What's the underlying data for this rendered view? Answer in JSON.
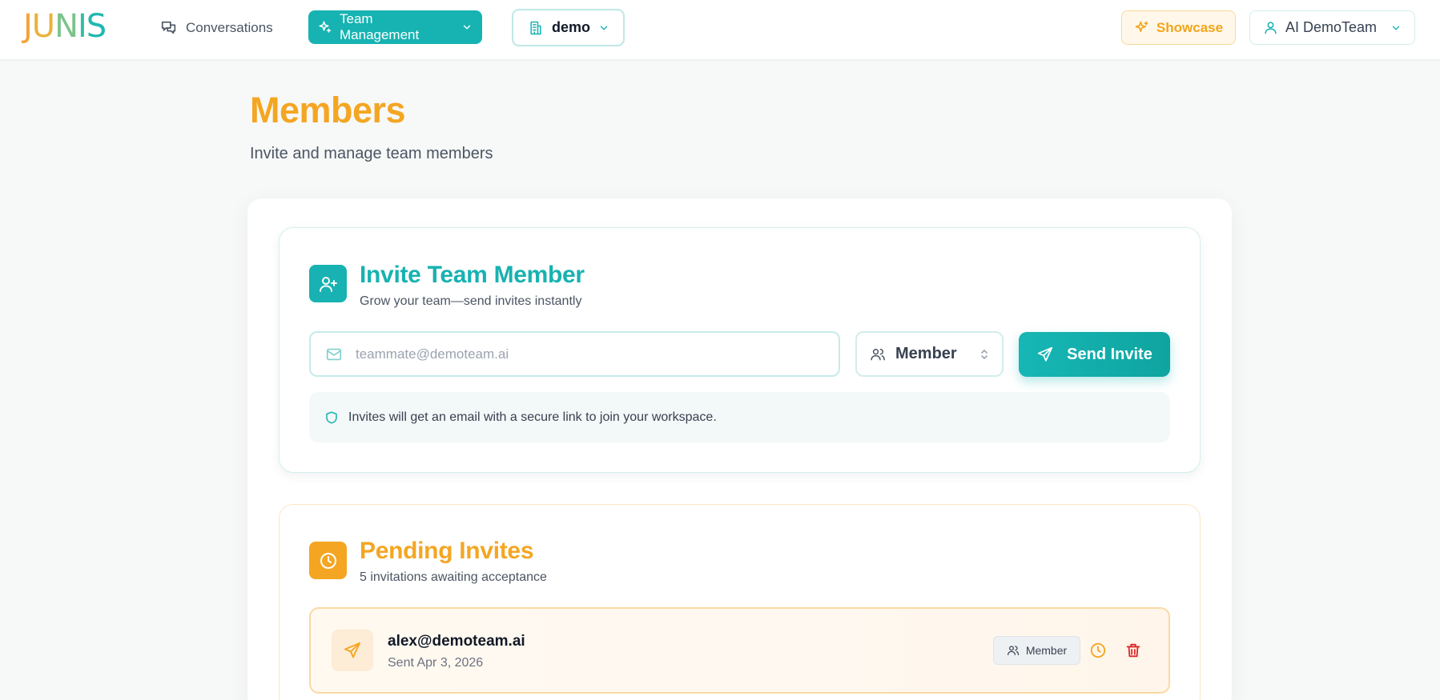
{
  "header": {
    "logo_text": [
      "J",
      "U",
      "N",
      "I",
      "S"
    ],
    "nav_conversations": "Conversations",
    "nav_team_management": "Team Management",
    "workspace": "demo",
    "showcase": "Showcase",
    "user": "AI DemoTeam"
  },
  "page": {
    "title": "Members",
    "subtitle": "Invite and manage team members"
  },
  "invite": {
    "title": "Invite Team Member",
    "subtitle": "Grow your team—send invites instantly",
    "email_placeholder": "teammate@demoteam.ai",
    "email_value": "",
    "role_selected": "Member",
    "send_label": "Send Invite",
    "notice": "Invites will get an email with a secure link to join your workspace."
  },
  "pending": {
    "title": "Pending Invites",
    "subtitle": "5 invitations awaiting acceptance",
    "items": [
      {
        "email": "alex@demoteam.ai",
        "sent": "Sent Apr 3, 2026",
        "role": "Member"
      }
    ]
  },
  "colors": {
    "teal": "#17b2b1",
    "amber": "#f4a622",
    "danger": "#dc2626"
  }
}
